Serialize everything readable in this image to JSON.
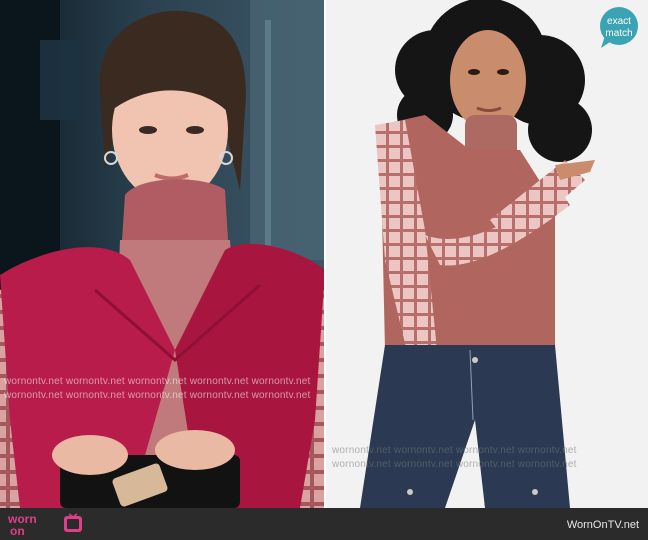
{
  "watermark_text": "wornontv.net",
  "badge": {
    "line1": "exact",
    "line2": "match",
    "color": "#3aa3b4"
  },
  "footer": {
    "logo_top": "worn",
    "logo_bottom": "on",
    "url": "WornOnTV.net",
    "logo_color": "#e03e8a"
  },
  "colors": {
    "footer_bg": "#2b2b2b",
    "vest": "#b71c4a",
    "turtleneck": "#b45f63",
    "plaid": "#e6b8b8",
    "jeans": "#2b3a52"
  }
}
